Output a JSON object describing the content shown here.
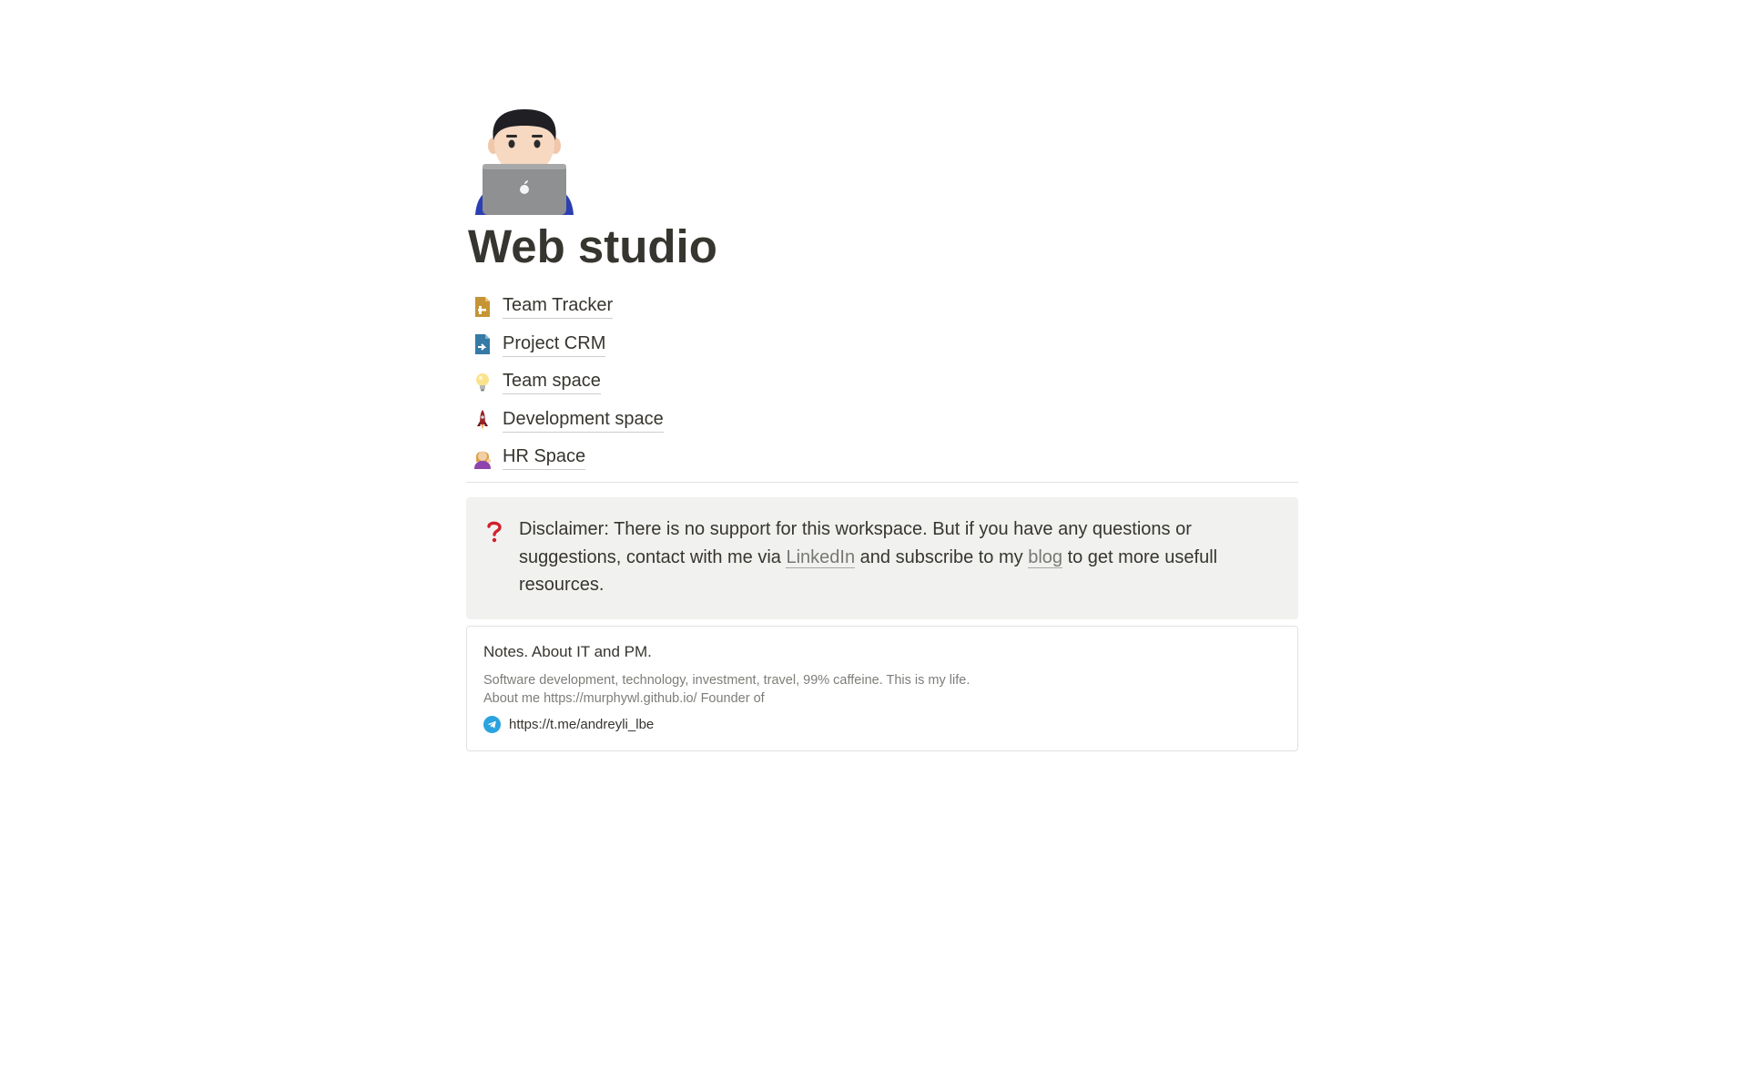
{
  "page": {
    "icon": "person-with-laptop-icon",
    "title": "Web studio"
  },
  "links": [
    {
      "label": "Team Tracker",
      "icon": "spreadsheet-document-icon",
      "color": "#c69435"
    },
    {
      "label": "Project CRM",
      "icon": "document-arrow-icon",
      "color": "#367aa5"
    },
    {
      "label": "Team space",
      "icon": "lightbulb-icon",
      "color": "#f5c542"
    },
    {
      "label": "Development space",
      "icon": "rocket-icon",
      "color": "#9b2226"
    },
    {
      "label": "HR Space",
      "icon": "person-tipping-hand-icon",
      "color": "#8e44ad"
    }
  ],
  "callout": {
    "icon": "red-question-mark-icon",
    "text_before": "Disclaimer: There is no support for this workspace. But if you have any questions or suggestions, contact with me via ",
    "link1": "LinkedIn",
    "text_middle": " and subscribe to my ",
    "link2": "blog",
    "text_after": " to get more usefull resources.",
    "background": "#f1f1ef"
  },
  "bookmark": {
    "title": "Notes. About IT and PM.",
    "description": "Software development, technology, investment, travel, 99% caffeine. This is my life. About me https://murphywl.github.io/ Founder of",
    "favicon": "telegram-icon",
    "url": "https://t.me/andreyli_lbe"
  }
}
